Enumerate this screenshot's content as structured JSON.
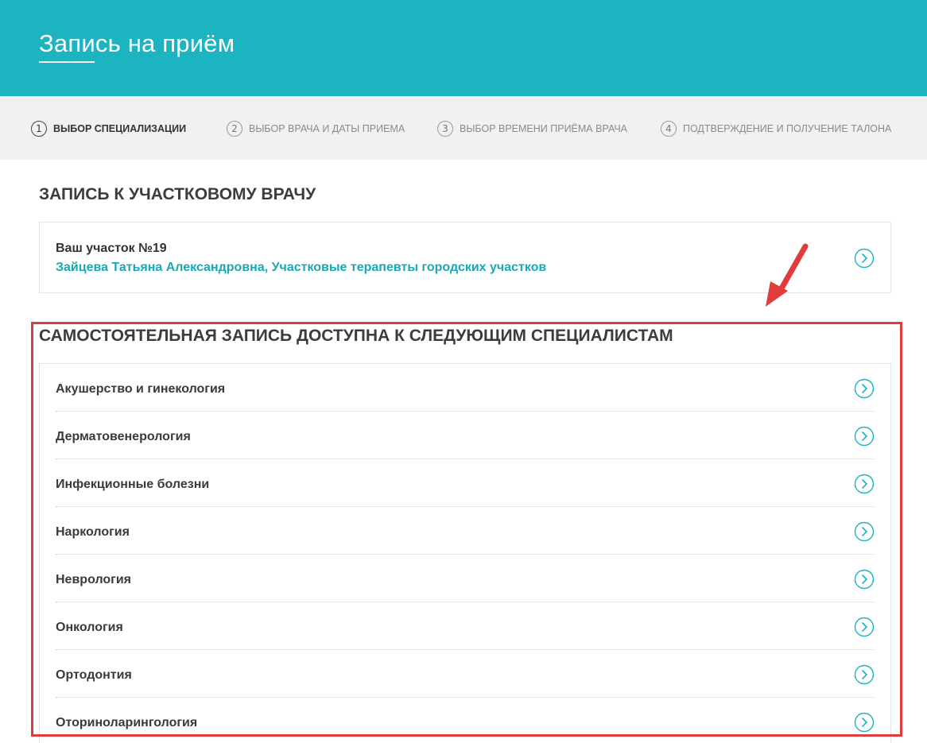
{
  "colors": {
    "accent": "#1cb4c0",
    "link": "#19a8b5",
    "highlight": "#e03c3c",
    "chevron": "#1cb4c0"
  },
  "header": {
    "title": "Запись на приём"
  },
  "steps": [
    {
      "num": "1",
      "label": "Выбор специализации",
      "active": true
    },
    {
      "num": "2",
      "label": "Выбор врача и даты приема",
      "active": false
    },
    {
      "num": "3",
      "label": "Выбор времени приёма врача",
      "active": false
    },
    {
      "num": "4",
      "label": "Подтверждение и получение талона",
      "active": false
    }
  ],
  "district_section": {
    "title": "Запись к участковому врачу",
    "district_label": "Ваш участок №19",
    "doctor": "Зайцева Татьяна Александровна, Участковые терапевты городских участков"
  },
  "specialists_section": {
    "title": "Самостоятельная запись доступна к следующим специалистам",
    "items": [
      "Акушерство и гинекология",
      "Дерматовенерология",
      "Инфекционные болезни",
      "Наркология",
      "Неврология",
      "Онкология",
      "Ортодонтия",
      "Оториноларингология"
    ]
  },
  "icons": {
    "chevron": "chevron-right-circle-icon",
    "annotation_arrow": "red-arrow-icon"
  }
}
